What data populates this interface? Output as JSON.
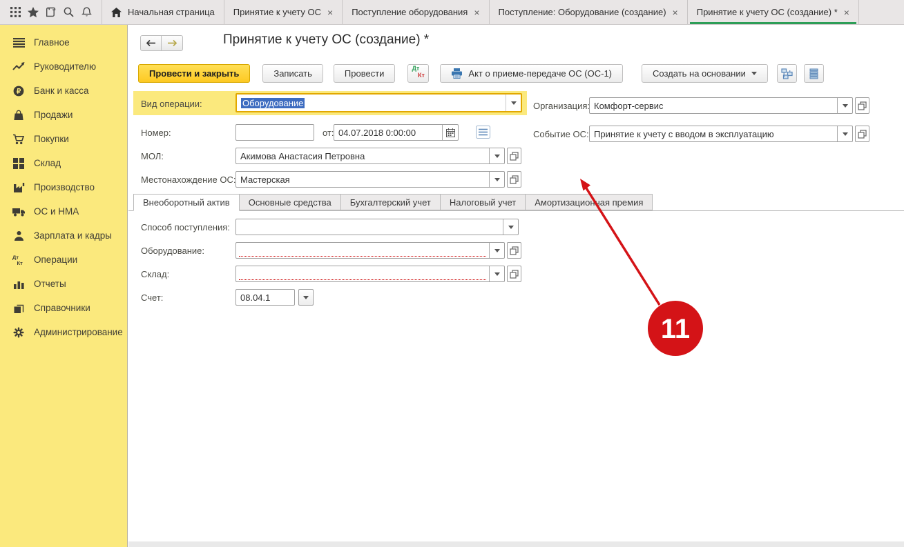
{
  "colors": {
    "sidebar_yellow": "#fbe97d",
    "primary_button_yellow": "#fdc922",
    "active_tab_green": "#2d9e57",
    "selection_blue": "#3d6cc0",
    "required_red": "#cc0000",
    "annotation_red": "#d41317"
  },
  "topbar": {
    "close_glyph": "×",
    "tabs": [
      {
        "label": "Начальная страница"
      },
      {
        "label": "Принятие к учету ОС"
      },
      {
        "label": "Поступление оборудования"
      },
      {
        "label": "Поступление: Оборудование (создание)"
      },
      {
        "label": "Принятие к учету ОС (создание) *"
      }
    ]
  },
  "sidebar": {
    "items": [
      {
        "label": "Главное"
      },
      {
        "label": "Руководителю"
      },
      {
        "label": "Банк и касса"
      },
      {
        "label": "Продажи"
      },
      {
        "label": "Покупки"
      },
      {
        "label": "Склад"
      },
      {
        "label": "Производство"
      },
      {
        "label": "ОС и НМА"
      },
      {
        "label": "Зарплата и кадры"
      },
      {
        "label": "Операции"
      },
      {
        "label": "Отчеты"
      },
      {
        "label": "Справочники"
      },
      {
        "label": "Администрирование"
      }
    ]
  },
  "form": {
    "title": "Принятие к учету ОС (создание) *",
    "toolbar": {
      "post_and_close": "Провести и закрыть",
      "write": "Записать",
      "post": "Провести",
      "dt": "Дт",
      "kt": "Кт",
      "act_label": "Акт о приеме-передаче ОС (ОС-1)",
      "create_based_on": "Создать на основании"
    },
    "fields": {
      "operation_type": {
        "label": "Вид операции:",
        "value": "Оборудование"
      },
      "number": {
        "label": "Номер:",
        "value": ""
      },
      "date": {
        "label": "от:",
        "value": "04.07.2018  0:00:00"
      },
      "mol": {
        "label": "МОЛ:",
        "value": "Акимова Анастасия Петровна"
      },
      "location": {
        "label": "Местонахождение ОС:",
        "value": "Мастерская"
      },
      "organization": {
        "label": "Организация:",
        "value": "Комфорт-сервис"
      },
      "os_event": {
        "label": "Событие ОС:",
        "value": "Принятие к учету с вводом в эксплуатацию"
      },
      "receipt_method": {
        "label": "Способ поступления:",
        "value": ""
      },
      "equipment": {
        "label": "Оборудование:",
        "value": ""
      },
      "warehouse": {
        "label": "Склад:",
        "value": ""
      },
      "account": {
        "label": "Счет:",
        "value": "08.04.1"
      }
    },
    "tabs": [
      {
        "label": "Внеоборотный актив"
      },
      {
        "label": "Основные средства"
      },
      {
        "label": "Бухгалтерский учет"
      },
      {
        "label": "Налоговый учет"
      },
      {
        "label": "Амортизационная премия"
      }
    ]
  },
  "annotation": {
    "number": "11"
  }
}
